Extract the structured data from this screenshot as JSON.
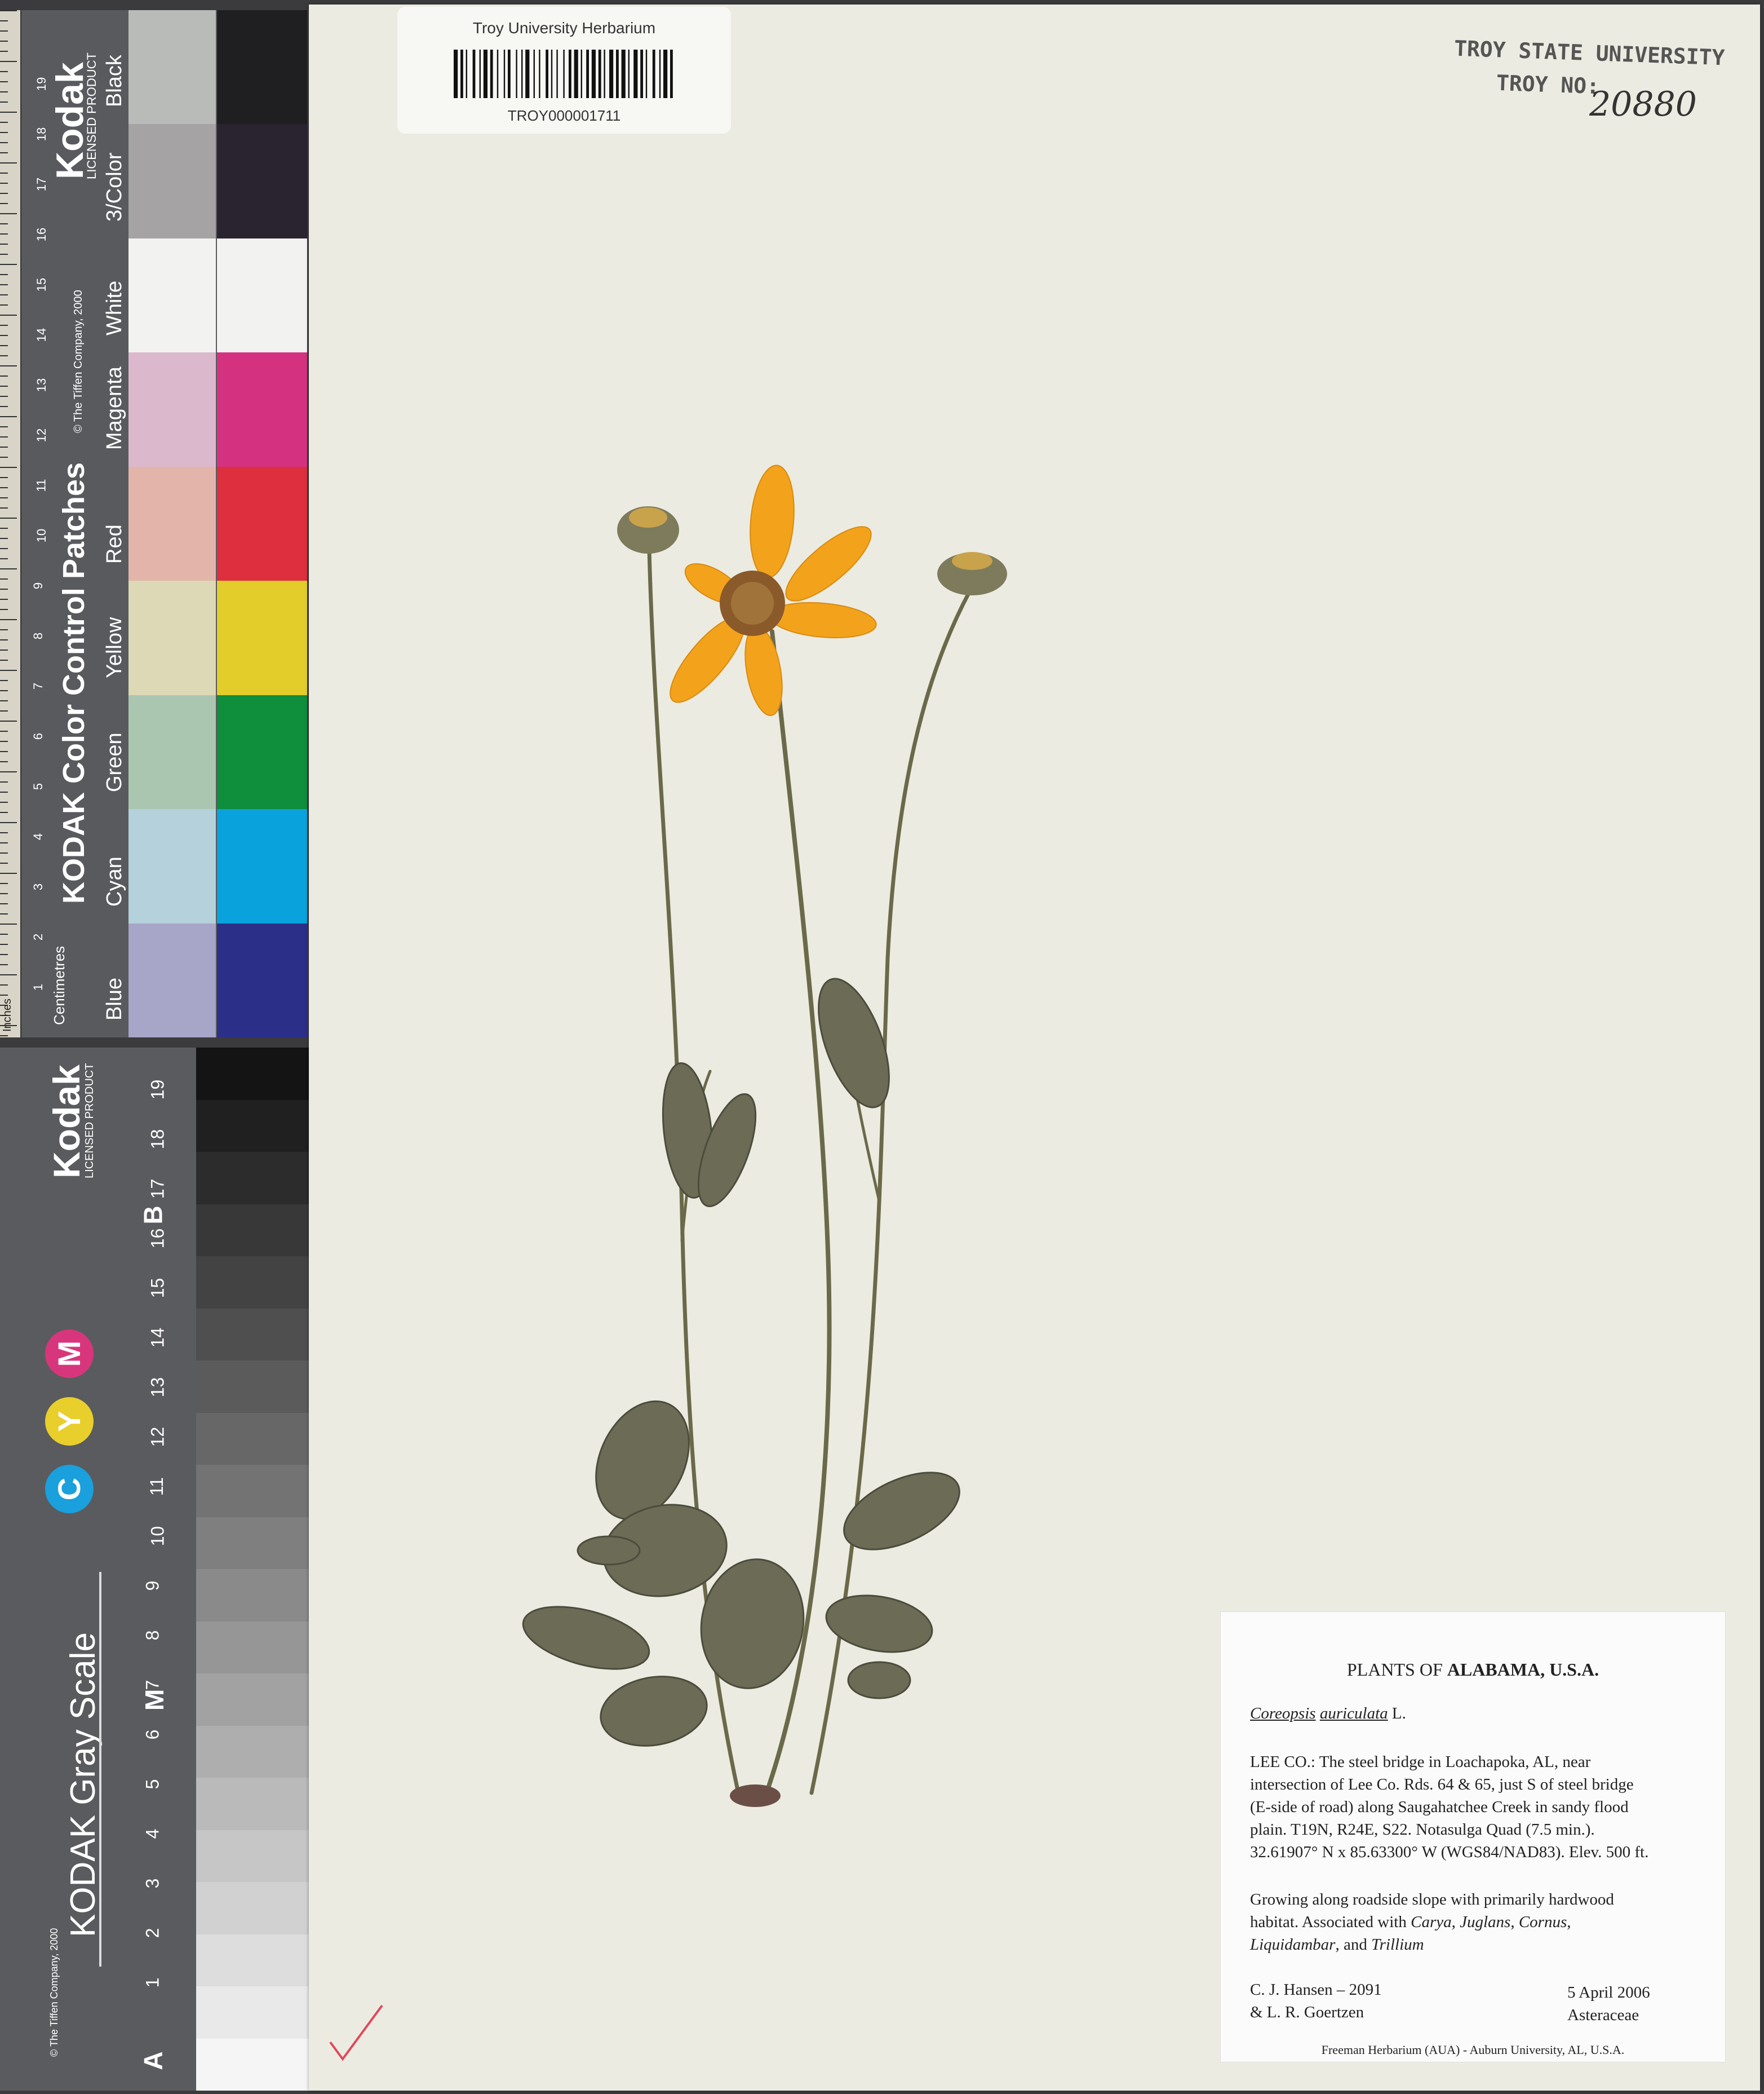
{
  "color_card": {
    "ruler_units_top": "Inches",
    "ruler_units_bottom": "Centimetres",
    "brand": "Kodak",
    "licensed": "LICENSED PRODUCT",
    "title": "KODAK Color Control Patches",
    "copyright": "© The Tiffen Company, 2000",
    "patches": [
      {
        "label": "Blue",
        "light": "#a7a5c8",
        "dark": "#2b2f88"
      },
      {
        "label": "Cyan",
        "light": "#b5d1dc",
        "dark": "#0aa2dc"
      },
      {
        "label": "Green",
        "light": "#abc6b0",
        "dark": "#0f8e3c"
      },
      {
        "label": "Yellow",
        "light": "#ddd9b6",
        "dark": "#e2cd2b"
      },
      {
        "label": "Red",
        "light": "#e3b5aa",
        "dark": "#de2f3f"
      },
      {
        "label": "Magenta",
        "light": "#dcb8cc",
        "dark": "#d43281"
      },
      {
        "label": "White",
        "light": "#f2f3f1",
        "dark": "#f2f3f1"
      },
      {
        "label": "3/Color",
        "light": "#a5a3a3",
        "dark": "#2a2430"
      },
      {
        "label": "Black",
        "light": "#b9bbb9",
        "dark": "#1f1e20"
      }
    ],
    "ruler_numbers": [
      "1",
      "2",
      "3",
      "4",
      "5",
      "6",
      "7",
      "8",
      "9",
      "10",
      "11",
      "12",
      "13",
      "14",
      "15",
      "16",
      "17",
      "18",
      "19"
    ]
  },
  "gray_scale": {
    "brand": "Kodak",
    "licensed": "LICENSED PRODUCT",
    "title": "KODAK Gray Scale",
    "copyright": "© The Tiffen Company, 2000",
    "cym": [
      "C",
      "Y",
      "M"
    ],
    "cym_colors": [
      "#1aa0dc",
      "#e8cf2c",
      "#d7367c"
    ],
    "letters": [
      "A",
      "M",
      "B"
    ],
    "steps": [
      "1",
      "2",
      "3",
      "4",
      "5",
      "6",
      "7",
      "8",
      "9",
      "10",
      "11",
      "12",
      "13",
      "14",
      "15",
      "16",
      "17",
      "18",
      "19"
    ]
  },
  "barcode_label": {
    "institution": "Troy University Herbarium",
    "catalog": "TROY000001711"
  },
  "stamp": {
    "line1": "TROY STATE UNIVERSITY",
    "line2": "TROY NO:",
    "number": "20880"
  },
  "label": {
    "heading_prefix": "PLANTS OF ",
    "heading_bold": "ALABAMA, U.S.A.",
    "taxon_genus": "Coreopsis",
    "taxon_epithet": "auriculata",
    "taxon_author": " L.",
    "locality": [
      "LEE CO.: The steel bridge in Loachapoka, AL, near",
      "intersection of Lee Co. Rds. 64 & 65, just S of steel bridge",
      "(E-side of road) along Saugahatchee Creek in sandy flood",
      "plain.  T19N, R24E, S22. Notasulga Quad (7.5 min.).",
      "32.61907° N x 85.63300° W (WGS84/NAD83). Elev. 500 ft."
    ],
    "habitat_1": "Growing along roadside slope with primarily hardwood",
    "habitat_2a": "habitat.  Associated with ",
    "habitat_genus1": "Carya",
    "habitat_genus2": "Juglans",
    "habitat_genus3": "Cornus",
    "habitat_genus4": "Liquidambar",
    "habitat_genus5": "Trillium",
    "collector_1": "C. J. Hansen – 2091",
    "collector_2": "& L. R. Goertzen",
    "date": "5 April 2006",
    "family": "Asteraceae",
    "footer": "Freeman Herbarium (AUA) - Auburn University, AL, U.S.A."
  }
}
